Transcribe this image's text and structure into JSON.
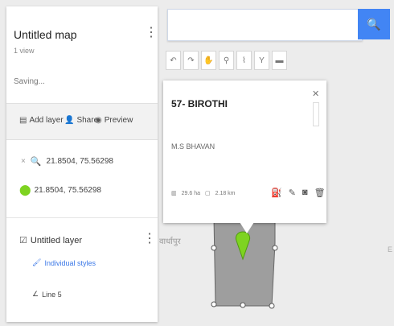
{
  "map": {
    "title": "Untitled map",
    "views": "1 view",
    "status": "Saving...",
    "place_label": "वार्धापुर"
  },
  "actions": {
    "add_layer": "Add layer",
    "share": "Share",
    "preview": "Preview"
  },
  "search_result": {
    "query": "21.8504, 75.56298"
  },
  "pin": {
    "coords": "21.8504, 75.56298"
  },
  "layer": {
    "name": "Untitled layer",
    "style": "Individual styles",
    "feature": "Line 5"
  },
  "search": {
    "placeholder": "",
    "button_icon": "search-icon"
  },
  "toolbar": {
    "tools": [
      "undo-icon",
      "redo-icon",
      "hand-icon",
      "marker-icon",
      "draw-line-icon",
      "directions-icon",
      "ruler-icon"
    ]
  },
  "popup": {
    "title": "57- BIROTHI",
    "description": "M.S BHAVAN",
    "area": "29.6 ha",
    "perimeter": "2.18 km"
  },
  "colors": {
    "accent": "#4285f4",
    "pin": "#7ed321",
    "polygon": "#9e9e9e"
  }
}
